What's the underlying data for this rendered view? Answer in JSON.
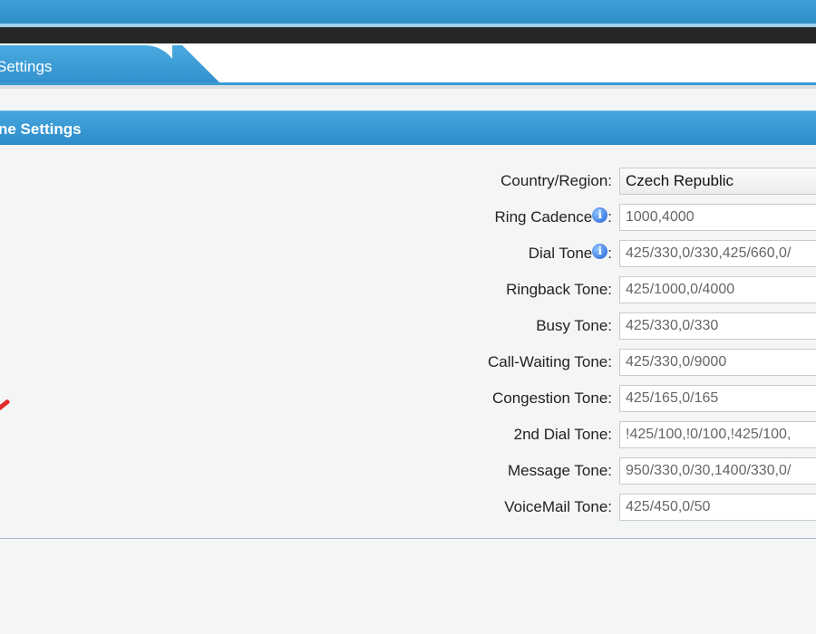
{
  "tab": {
    "label": "Settings"
  },
  "section": {
    "title": "ne Settings"
  },
  "form": {
    "rows": [
      {
        "label": "Country/Region:",
        "value": "Czech Republic"
      },
      {
        "label": "Ring Cadence",
        "value": "1000,4000",
        "has_info": true
      },
      {
        "label": "Dial Tone",
        "value": "425/330,0/330,425/660,0/",
        "has_info": true
      },
      {
        "label": "Ringback Tone:",
        "value": "425/1000,0/4000"
      },
      {
        "label": "Busy Tone:",
        "value": "425/330,0/330"
      },
      {
        "label": "Call-Waiting Tone:",
        "value": "425/330,0/9000"
      },
      {
        "label": "Congestion Tone:",
        "value": "425/165,0/165"
      },
      {
        "label": "2nd Dial Tone:",
        "value": "!425/100,!0/100,!425/100,"
      },
      {
        "label": "Message Tone:",
        "value": "950/330,0/30,1400/330,0/"
      },
      {
        "label": "VoiceMail Tone:",
        "value": "425/450,0/50"
      }
    ],
    "info_colon": ":",
    "info_icon_glyph": "i"
  },
  "icons": {
    "info": "info-icon",
    "annotation": "red-annotation-mark"
  },
  "colors": {
    "accent": "#3a9bd4",
    "banner": "#2f8cc6",
    "dark_strip": "#262626",
    "annotation": "#e42a2a"
  }
}
